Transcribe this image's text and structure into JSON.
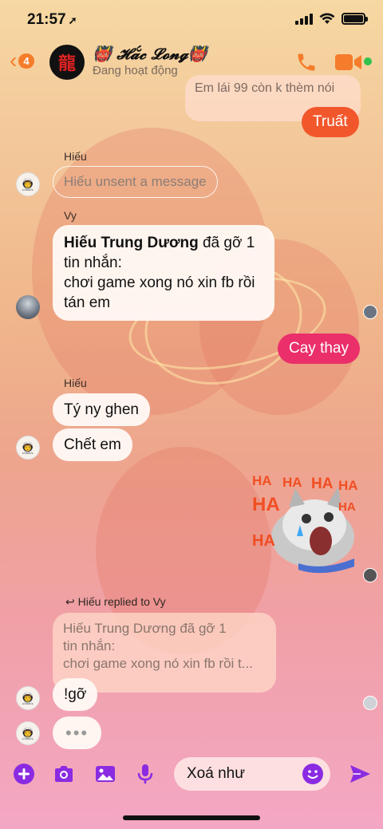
{
  "status_bar": {
    "time": "21:57"
  },
  "header": {
    "back_count": "4",
    "contact_name": "👹 𝓗𝓪̆́𝓬 𝓛𝓸𝓷𝓰👹",
    "status": "Đang hoạt động",
    "colors": {
      "accent": "#f57c2a",
      "online": "#31c24d"
    }
  },
  "messages": {
    "top_reply_preview": "Em lái 99 còn k thèm nói",
    "out_1": "Truất",
    "sender_hieu_1": "Hiếu",
    "unsent_notice": "Hiếu unsent a message",
    "sender_vy": "Vy",
    "vy_bold": "Hiếu Trung Dương",
    "vy_text_1": " đã gỡ 1",
    "vy_text_2": "tin nhắn:",
    "vy_text_3": "chơi game xong nó xin fb rồi",
    "vy_text_4": "tán em",
    "out_2": "Cay thay",
    "sender_hieu_2": "Hiếu",
    "hieu_msg_1": "Tý ny ghen",
    "hieu_msg_2": "Chết em",
    "sticker_text": "HA HA HA HA HA HA HA",
    "reply_label": "Hiếu replied to Vy",
    "reply_quote_1": "Hiếu Trung Dương đã gỡ 1",
    "reply_quote_2": "tin nhắn:",
    "reply_quote_3": "chơi game xong nó xin fb rồi t...",
    "hieu_msg_3": "!gỡ",
    "typing": "•••"
  },
  "composer": {
    "draft": "Xoá như",
    "icons": [
      "plus-icon",
      "camera-icon",
      "image-icon",
      "mic-icon",
      "emoji-icon",
      "send-icon"
    ],
    "icon_color": "#8a2be2"
  }
}
